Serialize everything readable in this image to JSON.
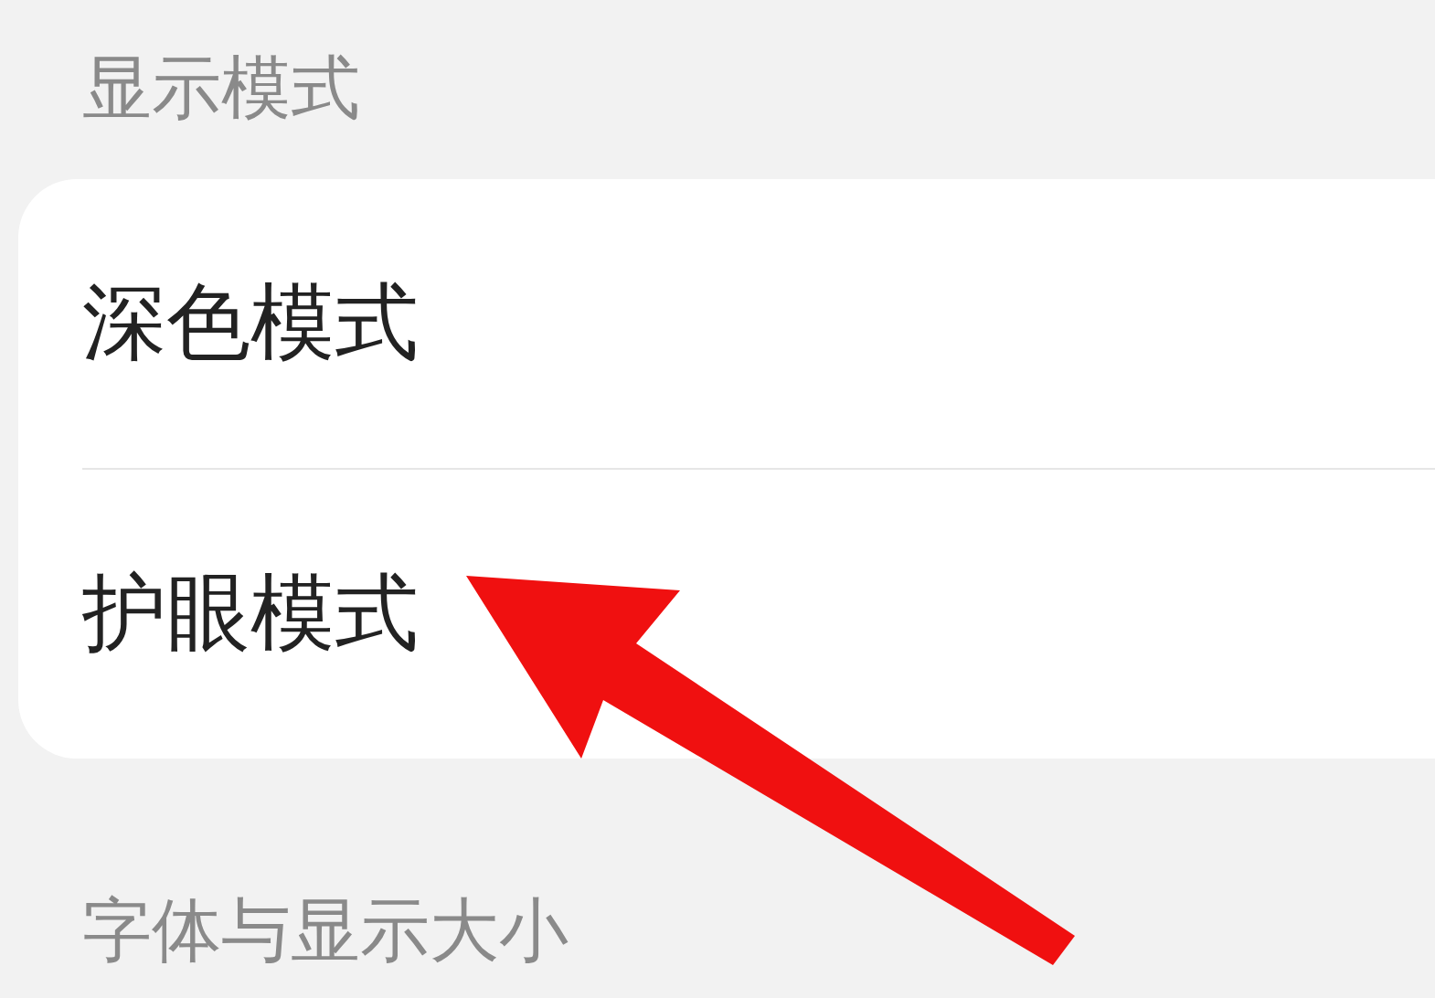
{
  "sections": [
    {
      "header": "显示模式",
      "items": [
        {
          "label": "深色模式"
        },
        {
          "label": "护眼模式"
        }
      ]
    },
    {
      "header": "字体与显示大小"
    }
  ]
}
